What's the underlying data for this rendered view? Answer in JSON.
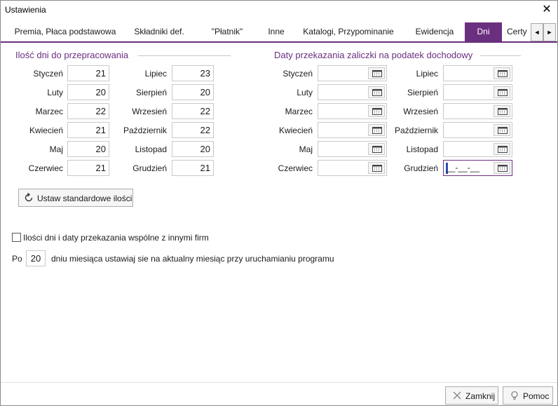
{
  "window": {
    "title": "Ustawienia"
  },
  "tabs": [
    {
      "label": "Premia, Płaca podstawowa"
    },
    {
      "label": "Składniki def."
    },
    {
      "label": "\"Płatnik\""
    },
    {
      "label": "Inne"
    },
    {
      "label": "Katalogi, Przypominanie"
    },
    {
      "label": "Ewidencja"
    },
    {
      "label": "Dni"
    },
    {
      "label": "Certy"
    }
  ],
  "tab_scroll": {
    "left": "◄",
    "right": "►"
  },
  "work_days": {
    "title": "Ilość dni do przepracowania",
    "months_left": [
      {
        "label": "Styczeń",
        "value": "21"
      },
      {
        "label": "Luty",
        "value": "20"
      },
      {
        "label": "Marzec",
        "value": "22"
      },
      {
        "label": "Kwiecień",
        "value": "21"
      },
      {
        "label": "Maj",
        "value": "20"
      },
      {
        "label": "Czerwiec",
        "value": "21"
      }
    ],
    "months_right": [
      {
        "label": "Lipiec",
        "value": "23"
      },
      {
        "label": "Sierpień",
        "value": "20"
      },
      {
        "label": "Wrzesień",
        "value": "22"
      },
      {
        "label": "Październik",
        "value": "22"
      },
      {
        "label": "Listopad",
        "value": "20"
      },
      {
        "label": "Grudzień",
        "value": "21"
      }
    ],
    "reset_button": "Ustaw standardowe ilości"
  },
  "tax_dates": {
    "title": "Daty przekazania zaliczki na podatek dochodowy",
    "months_left": [
      {
        "label": "Styczeń",
        "value": ""
      },
      {
        "label": "Luty",
        "value": ""
      },
      {
        "label": "Marzec",
        "value": ""
      },
      {
        "label": "Kwiecień",
        "value": ""
      },
      {
        "label": "Maj",
        "value": ""
      },
      {
        "label": "Czerwiec",
        "value": ""
      }
    ],
    "months_right": [
      {
        "label": "Lipiec",
        "value": ""
      },
      {
        "label": "Sierpień",
        "value": ""
      },
      {
        "label": "Wrzesień",
        "value": ""
      },
      {
        "label": "Październik",
        "value": ""
      },
      {
        "label": "Listopad",
        "value": ""
      },
      {
        "label": "Grudzień",
        "value": "__-__-__"
      }
    ]
  },
  "shared_checkbox": {
    "label": "Ilości dni i daty przekazania wspólne z innymi firm",
    "checked": false
  },
  "day_setting": {
    "prefix": "Po",
    "value": "20",
    "suffix": "dniu miesiąca ustawiaj sie na aktualny miesiąc przy uruchamianiu programu"
  },
  "footer": {
    "close_label": "Zamknij",
    "help_label": "Pomoc"
  },
  "colors": {
    "accent": "#6b2f80",
    "caret": "#2d4fb3"
  }
}
